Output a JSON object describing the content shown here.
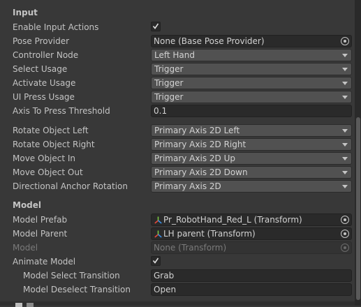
{
  "input": {
    "header": "Input",
    "enable_input_actions": {
      "label": "Enable Input Actions",
      "checked": true
    },
    "pose_provider": {
      "label": "Pose Provider",
      "value": "None (Base Pose Provider)"
    },
    "controller_node": {
      "label": "Controller Node",
      "value": "Left Hand"
    },
    "select_usage": {
      "label": "Select Usage",
      "value": "Trigger"
    },
    "activate_usage": {
      "label": "Activate Usage",
      "value": "Trigger"
    },
    "ui_press_usage": {
      "label": "UI Press Usage",
      "value": "Trigger"
    },
    "axis_to_press_threshold": {
      "label": "Axis To Press Threshold",
      "value": "0.1"
    },
    "rotate_object_left": {
      "label": "Rotate Object Left",
      "value": "Primary Axis 2D Left"
    },
    "rotate_object_right": {
      "label": "Rotate Object Right",
      "value": "Primary Axis 2D Right"
    },
    "move_object_in": {
      "label": "Move Object In",
      "value": "Primary Axis 2D Up"
    },
    "move_object_out": {
      "label": "Move Object Out",
      "value": "Primary Axis 2D Down"
    },
    "directional_anchor_rotation": {
      "label": "Directional Anchor Rotation",
      "value": "Primary Axis 2D"
    }
  },
  "model": {
    "header": "Model",
    "model_prefab": {
      "label": "Model Prefab",
      "value": "Pr_RobotHand_Red_L (Transform)",
      "icon": "transform-axes-icon"
    },
    "model_parent": {
      "label": "Model Parent",
      "value": "LH parent (Transform)",
      "icon": "transform-axes-icon"
    },
    "model": {
      "label": "Model",
      "value": "None (Transform)",
      "disabled": true
    },
    "animate_model": {
      "label": "Animate Model",
      "checked": true
    },
    "model_select_transition": {
      "label": "Model Select Transition",
      "value": "Grab"
    },
    "model_deselect_transition": {
      "label": "Model Deselect Transition",
      "value": "Open"
    }
  },
  "colors": {
    "background": "#383838",
    "dropdown": "#515151",
    "field": "#2a2a2a",
    "text": "#c4c4c4",
    "disabled_text": "#7a7a7a"
  }
}
